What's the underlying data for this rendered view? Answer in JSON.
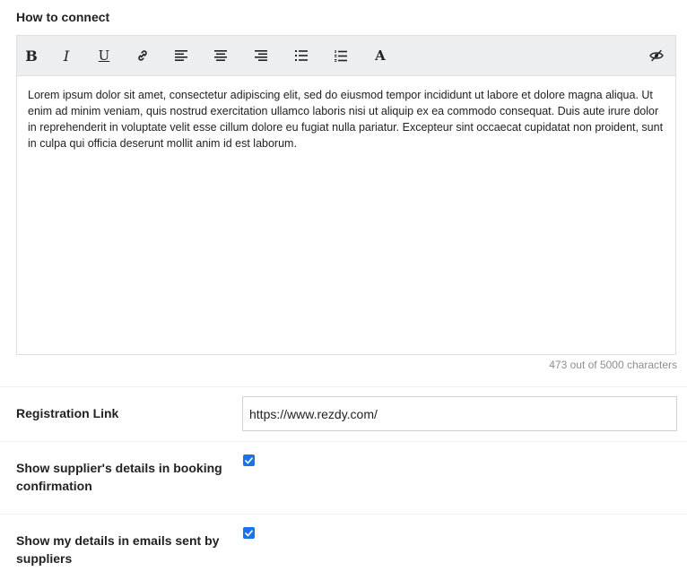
{
  "how_to_connect": {
    "title": "How to connect",
    "toolbar": {
      "bold": "B",
      "italic": "I",
      "underline": "U",
      "font": "A"
    },
    "content": "Lorem ipsum dolor sit amet, consectetur adipiscing elit, sed do eiusmod tempor incididunt ut labore et dolore magna aliqua. Ut enim ad minim veniam, quis nostrud exercitation ullamco laboris nisi ut aliquip ex ea commodo consequat. Duis aute irure dolor in reprehenderit in voluptate velit esse cillum dolore eu fugiat nulla pariatur. Excepteur sint occaecat cupidatat non proident, sunt in culpa qui officia deserunt mollit anim id est laborum.",
    "char_count": "473 out of 5000 characters"
  },
  "registration": {
    "label": "Registration Link",
    "value": "https://www.rezdy.com/"
  },
  "options": {
    "supplier_details": {
      "label_line1": "Show supplier's details in booking",
      "label_line2": "confirmation",
      "checked": true
    },
    "my_details": {
      "label_line1": "Show my details in emails sent by",
      "label_line2": "suppliers",
      "checked": true
    }
  },
  "colors": {
    "accent": "#1a73e8",
    "toolbar_bg": "#eceef0",
    "muted_text": "#8a8f96"
  }
}
